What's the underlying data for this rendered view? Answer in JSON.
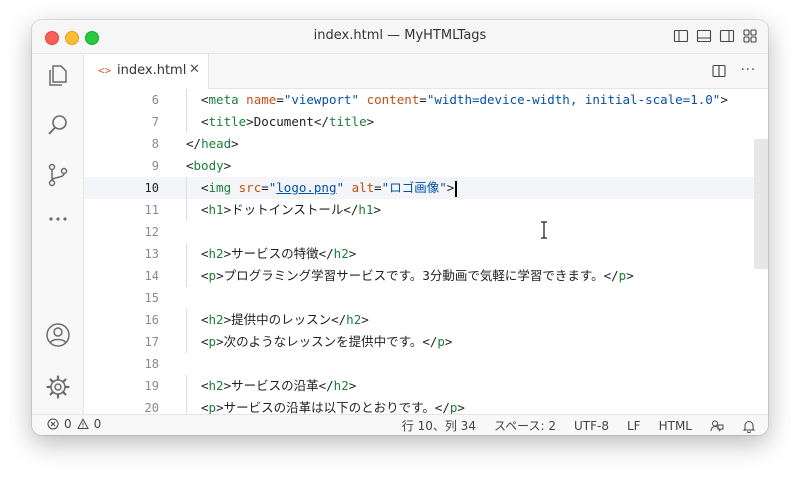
{
  "window": {
    "title": "index.html — MyHTMLTags"
  },
  "tab": {
    "icon_glyph": "<>",
    "label": "index.html",
    "close_glyph": "✕"
  },
  "tab_actions": {
    "more_glyph": "···"
  },
  "editor": {
    "current_line": 10,
    "lines": [
      {
        "n": "6",
        "indent": 1,
        "tokens": [
          [
            "punct",
            "<"
          ],
          [
            "tag",
            "meta"
          ],
          [
            "punct",
            " "
          ],
          [
            "attr",
            "name"
          ],
          [
            "punct",
            "="
          ],
          [
            "str",
            "\"viewport\""
          ],
          [
            "punct",
            " "
          ],
          [
            "attr",
            "content"
          ],
          [
            "punct",
            "="
          ],
          [
            "str",
            "\"width=device-width, initial-scale=1.0\""
          ],
          [
            "punct",
            ">"
          ]
        ]
      },
      {
        "n": "7",
        "indent": 1,
        "tokens": [
          [
            "punct",
            "<"
          ],
          [
            "tag",
            "title"
          ],
          [
            "punct",
            ">Document</"
          ],
          [
            "tag",
            "title"
          ],
          [
            "punct",
            ">"
          ]
        ]
      },
      {
        "n": "8",
        "indent": 0,
        "tokens": [
          [
            "punct",
            "</"
          ],
          [
            "tag",
            "head"
          ],
          [
            "punct",
            ">"
          ]
        ]
      },
      {
        "n": "9",
        "indent": 0,
        "tokens": [
          [
            "punct",
            "<"
          ],
          [
            "tag",
            "body"
          ],
          [
            "punct",
            ">"
          ]
        ]
      },
      {
        "n": "10",
        "indent": 1,
        "tokens": [
          [
            "punct",
            "<"
          ],
          [
            "tag",
            "img"
          ],
          [
            "punct",
            " "
          ],
          [
            "attr",
            "src"
          ],
          [
            "punct",
            "="
          ],
          [
            "str",
            "\""
          ],
          [
            "stru",
            "logo.png"
          ],
          [
            "str",
            "\""
          ],
          [
            "punct",
            " "
          ],
          [
            "attr",
            "alt"
          ],
          [
            "punct",
            "="
          ],
          [
            "str",
            "\"ロゴ画像\""
          ],
          [
            "punct",
            ">"
          ]
        ]
      },
      {
        "n": "11",
        "indent": 1,
        "tokens": [
          [
            "punct",
            "<"
          ],
          [
            "tag",
            "h1"
          ],
          [
            "punct",
            ">ドットインストール</"
          ],
          [
            "tag",
            "h1"
          ],
          [
            "punct",
            ">"
          ]
        ]
      },
      {
        "n": "12",
        "indent": 0,
        "tokens": []
      },
      {
        "n": "13",
        "indent": 1,
        "tokens": [
          [
            "punct",
            "<"
          ],
          [
            "tag",
            "h2"
          ],
          [
            "punct",
            ">サービスの特徴</"
          ],
          [
            "tag",
            "h2"
          ],
          [
            "punct",
            ">"
          ]
        ]
      },
      {
        "n": "14",
        "indent": 1,
        "tokens": [
          [
            "punct",
            "<"
          ],
          [
            "tag",
            "p"
          ],
          [
            "punct",
            ">プログラミング学習サービスです。3分動画で気軽に学習できます。</"
          ],
          [
            "tag",
            "p"
          ],
          [
            "punct",
            ">"
          ]
        ]
      },
      {
        "n": "15",
        "indent": 0,
        "tokens": []
      },
      {
        "n": "16",
        "indent": 1,
        "tokens": [
          [
            "punct",
            "<"
          ],
          [
            "tag",
            "h2"
          ],
          [
            "punct",
            ">提供中のレッスン</"
          ],
          [
            "tag",
            "h2"
          ],
          [
            "punct",
            ">"
          ]
        ]
      },
      {
        "n": "17",
        "indent": 1,
        "tokens": [
          [
            "punct",
            "<"
          ],
          [
            "tag",
            "p"
          ],
          [
            "punct",
            ">次のようなレッスンを提供中です。</"
          ],
          [
            "tag",
            "p"
          ],
          [
            "punct",
            ">"
          ]
        ]
      },
      {
        "n": "18",
        "indent": 0,
        "tokens": []
      },
      {
        "n": "19",
        "indent": 1,
        "tokens": [
          [
            "punct",
            "<"
          ],
          [
            "tag",
            "h2"
          ],
          [
            "punct",
            ">サービスの沿革</"
          ],
          [
            "tag",
            "h2"
          ],
          [
            "punct",
            ">"
          ]
        ]
      },
      {
        "n": "20",
        "indent": 1,
        "tokens": [
          [
            "punct",
            "<"
          ],
          [
            "tag",
            "p"
          ],
          [
            "punct",
            ">サービスの沿革は以下のとおりです。</"
          ],
          [
            "tag",
            "p"
          ],
          [
            "punct",
            ">"
          ]
        ]
      }
    ]
  },
  "status": {
    "errors": "0",
    "warnings": "0",
    "position": "行 10、列 34",
    "spaces": "スペース: 2",
    "encoding": "UTF-8",
    "eol": "LF",
    "language": "HTML"
  },
  "colors": {
    "tag": "#1a7f38",
    "attr": "#c2500f",
    "string": "#0451a5",
    "current_line_bg": "#f3f5f8"
  }
}
